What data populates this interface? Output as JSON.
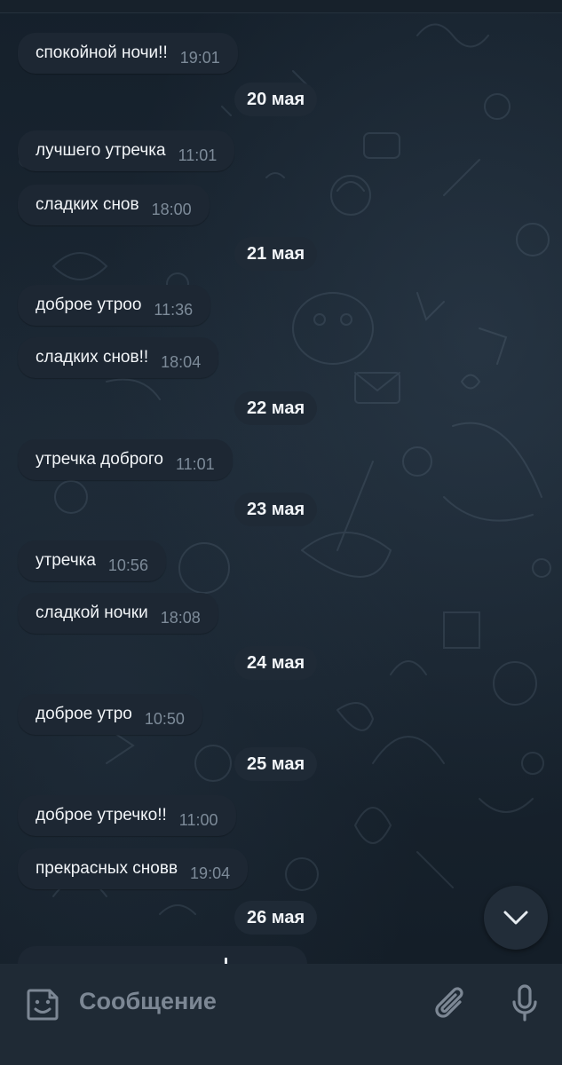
{
  "messages": [
    {
      "text": "спокойной ночи!!",
      "time": "19:01"
    },
    {
      "text": "лучшего утречка",
      "time": "11:01"
    },
    {
      "text": "сладких снов",
      "time": "18:00"
    },
    {
      "text": "доброе утроо",
      "time": "11:36"
    },
    {
      "text": "сладких снов!!",
      "time": "18:04"
    },
    {
      "text": "утречка доброго",
      "time": "11:01"
    },
    {
      "text": "утречка",
      "time": "10:56"
    },
    {
      "text": "сладкой ночки",
      "time": "18:08"
    },
    {
      "text": "доброе утро",
      "time": "10:50"
    },
    {
      "text": "доброе утречко!!",
      "time": "11:00"
    },
    {
      "text": "прекрасных сновв",
      "time": "19:04"
    }
  ],
  "dates": [
    "20 мая",
    "21 мая",
    "22 мая",
    "23 мая",
    "24 мая",
    "25 мая",
    "26 мая"
  ],
  "input": {
    "placeholder": "Сообщение"
  },
  "icons": {
    "emoji": "sticker-emoji-icon",
    "attach": "paperclip-icon",
    "mic": "microphone-icon",
    "scroll": "chevron-down-icon"
  },
  "colors": {
    "background": "#17212b",
    "bubble": "#1d2733",
    "text": "#f2f5f8",
    "time": "#7d8b99",
    "input_bar": "#1f2a35"
  }
}
